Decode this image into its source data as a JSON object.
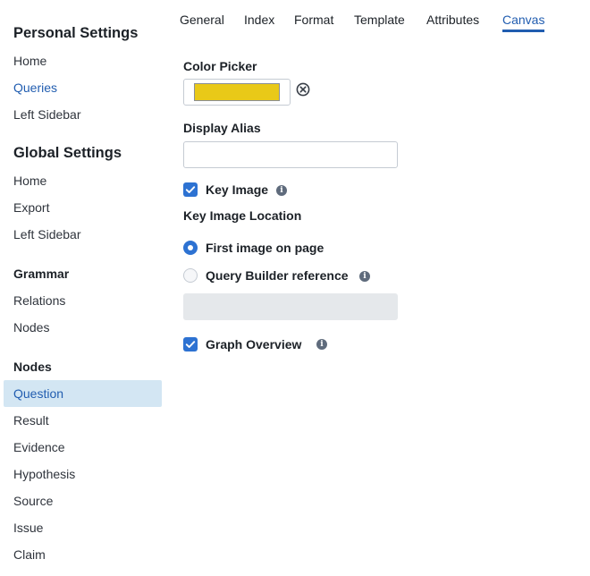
{
  "sidebar": {
    "personal": {
      "title": "Personal Settings",
      "items": [
        "Home",
        "Queries",
        "Left Sidebar"
      ]
    },
    "global": {
      "title": "Global Settings",
      "items": [
        "Home",
        "Export",
        "Left Sidebar"
      ]
    },
    "grammar": {
      "title": "Grammar",
      "items": [
        "Relations",
        "Nodes"
      ]
    },
    "nodes": {
      "title": "Nodes",
      "items": [
        "Question",
        "Result",
        "Evidence",
        "Hypothesis",
        "Source",
        "Issue",
        "Claim"
      ],
      "active": "Question"
    }
  },
  "tabs": {
    "items": [
      "General",
      "Index",
      "Format",
      "Template",
      "Attributes",
      "Canvas"
    ],
    "active": "Canvas"
  },
  "form": {
    "color_picker_label": "Color Picker",
    "color_value": "#e9c918",
    "display_alias_label": "Display Alias",
    "display_alias_value": "",
    "key_image_label": "Key Image",
    "key_image_checked": true,
    "key_image_location_label": "Key Image Location",
    "location_options": [
      "First image on page",
      "Query Builder reference"
    ],
    "location_selected": "First image on page",
    "query_builder_value": "",
    "graph_overview_label": "Graph Overview",
    "graph_overview_checked": true
  },
  "colors": {
    "accent": "#2d72d2",
    "link": "#215db0",
    "active_bg": "#d3e6f3",
    "swatch": "#e9c918"
  }
}
